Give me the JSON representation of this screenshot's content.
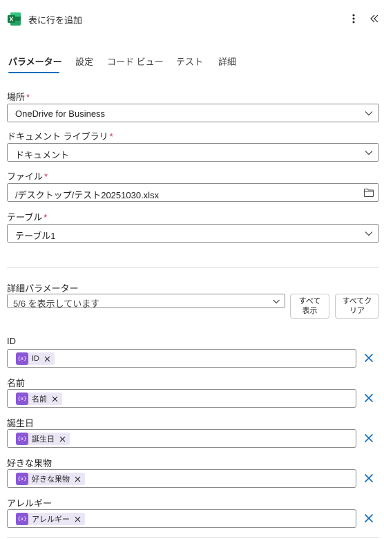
{
  "header": {
    "title": "表に行を追加",
    "app_icon": "excel-icon",
    "brand_color": "#107c41"
  },
  "tabs": [
    {
      "label": "パラメーター",
      "active": true
    },
    {
      "label": "設定"
    },
    {
      "label": "コード ビュー"
    },
    {
      "label": "テスト"
    },
    {
      "label": "詳細"
    }
  ],
  "accent_color": "#0f6cbd",
  "required_mark": "*",
  "fields": {
    "location": {
      "label": "場所",
      "value": "OneDrive for Business"
    },
    "library": {
      "label": "ドキュメント ライブラリ",
      "value": "ドキュメント"
    },
    "file": {
      "label": "ファイル",
      "value": "/デスクトップ/テスト20251030.xlsx"
    },
    "table": {
      "label": "テーブル",
      "value": "テーブル1"
    }
  },
  "advanced": {
    "label": "詳細パラメーター",
    "selected": "5/6 を表示しています",
    "show_all_label": "すべて\n表示",
    "clear_all_label": "すべてク\nリア"
  },
  "columns": [
    {
      "label": "ID",
      "token": "ID"
    },
    {
      "label": "名前",
      "token": "名前"
    },
    {
      "label": "誕生日",
      "token": "誕生日"
    },
    {
      "label": "好きな果物",
      "token": "好きな果物"
    },
    {
      "label": "アレルギー",
      "token": "アレルギー"
    }
  ],
  "token_icon_text": "{x}",
  "token_color": "#8a57d6",
  "delete_color": "#0f6cbd"
}
